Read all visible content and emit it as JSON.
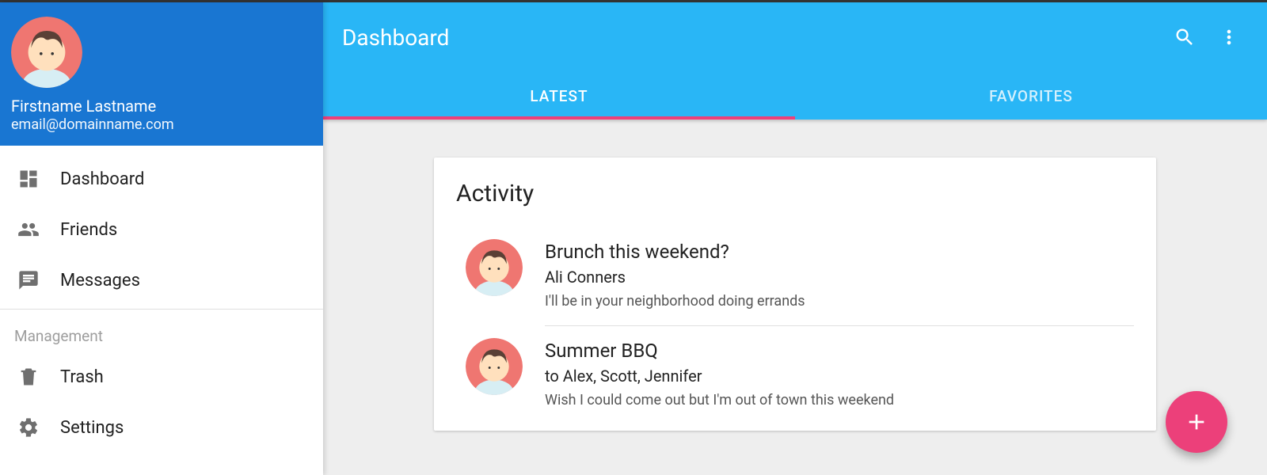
{
  "profile": {
    "name": "Firstname Lastname",
    "email": "email@domainname.com"
  },
  "sidebar": {
    "items": [
      {
        "icon": "dashboard-icon",
        "label": "Dashboard"
      },
      {
        "icon": "people-icon",
        "label": "Friends"
      },
      {
        "icon": "chat-icon",
        "label": "Messages"
      }
    ],
    "section_label": "Management",
    "items2": [
      {
        "icon": "trash-icon",
        "label": "Trash"
      },
      {
        "icon": "gear-icon",
        "label": "Settings"
      }
    ]
  },
  "header": {
    "title": "Dashboard",
    "tabs": [
      {
        "label": "LATEST",
        "active": true
      },
      {
        "label": "FAVORITES",
        "active": false
      }
    ]
  },
  "card": {
    "title": "Activity",
    "items": [
      {
        "title": "Brunch this weekend?",
        "subtitle": "Ali Conners",
        "text": "I'll be in your neighborhood doing errands"
      },
      {
        "title": "Summer BBQ",
        "subtitle": "to Alex, Scott, Jennifer",
        "text": "Wish I could come out but I'm out of town this weekend"
      }
    ]
  },
  "colors": {
    "sidebar_header": "#1976d2",
    "appbar": "#29b6f6",
    "accent": "#ec407a"
  }
}
